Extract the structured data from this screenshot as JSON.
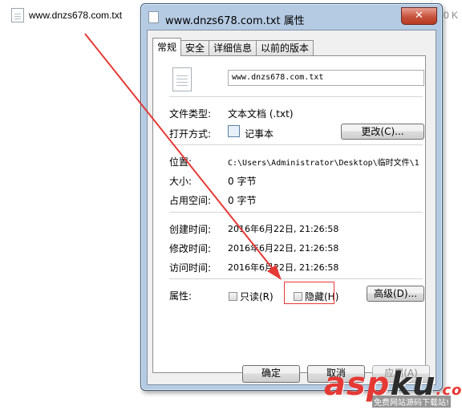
{
  "background": {
    "file_name": "www.dnzs678.com.txt",
    "size_fragment": "0 K"
  },
  "dialog": {
    "title": "www.dnzs678.com.txt 属性",
    "close_glyph": "✕",
    "tabs": [
      {
        "label": "常规",
        "active": true
      },
      {
        "label": "安全",
        "active": false
      },
      {
        "label": "详细信息",
        "active": false
      },
      {
        "label": "以前的版本",
        "active": false
      }
    ],
    "general": {
      "file_name_value": "www.dnzs678.com.txt",
      "type_label": "文件类型:",
      "type_value": "文本文档 (.txt)",
      "opens_with_label": "打开方式:",
      "opens_with_value": "记事本",
      "change_button": "更改(C)...",
      "location_label": "位置:",
      "location_value": "C:\\Users\\Administrator\\Desktop\\临时文件\\1",
      "size_label": "大小:",
      "size_value": "0 字节",
      "size_on_disk_label": "占用空间:",
      "size_on_disk_value": "0 字节",
      "created_label": "创建时间:",
      "created_value": "2016年6月22日, 21:26:58",
      "modified_label": "修改时间:",
      "modified_value": "2016年6月22日, 21:26:58",
      "accessed_label": "访问时间:",
      "accessed_value": "2016年6月22日, 21:26:58",
      "attributes_label": "属性:",
      "readonly_label": "只读(R)",
      "readonly_checked": false,
      "hidden_label": "隐藏(H)",
      "hidden_checked": false,
      "advanced_button": "高级(D)..."
    },
    "buttons": {
      "ok": "确定",
      "cancel": "取消",
      "apply": "应用(A)"
    }
  },
  "annotation": {
    "color": "#e53935"
  },
  "watermark": {
    "brand_a": "asp",
    "brand_b": "ku",
    "brand_c": ".com",
    "tagline": "免费网站源码下载站!"
  }
}
